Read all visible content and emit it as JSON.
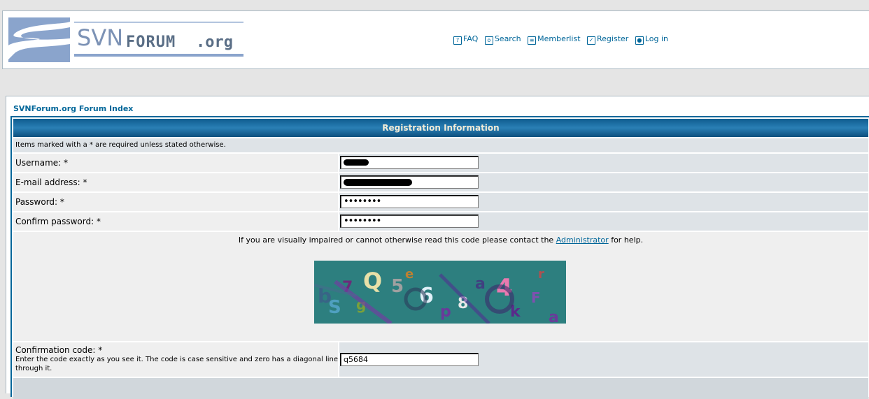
{
  "logo": {
    "text_svn": "SVN",
    "text_forum": "FORUM",
    "text_org": ".org"
  },
  "nav": [
    {
      "label": "FAQ",
      "icon": "faq-icon"
    },
    {
      "label": "Search",
      "icon": "search-icon"
    },
    {
      "label": "Memberlist",
      "icon": "memberlist-icon"
    },
    {
      "label": "Register",
      "icon": "register-icon"
    },
    {
      "label": "Log in",
      "icon": "login-icon"
    }
  ],
  "breadcrumb": "SVNForum.org Forum Index",
  "form": {
    "title": "Registration Information",
    "note": "Items marked with a * are required unless stated otherwise.",
    "username_label": "Username: *",
    "email_label": "E-mail address: *",
    "password_label": "Password: *",
    "password_value": "••••••••",
    "confirm_label": "Confirm password: *",
    "confirm_value": "••••••••",
    "captcha_note_before": "If you are visually impaired or cannot otherwise read this code please contact the",
    "captcha_link": "Administrator",
    "captcha_note_after": "for help.",
    "code_label": "Confirmation code: *",
    "code_help": "Enter the code exactly as you see it. The code is case sensitive and zero has a diagonal line through it.",
    "code_value": "q5684"
  },
  "colors": {
    "accent": "#006699",
    "row_light": "#efefef",
    "row_dark": "#dee3e7"
  }
}
